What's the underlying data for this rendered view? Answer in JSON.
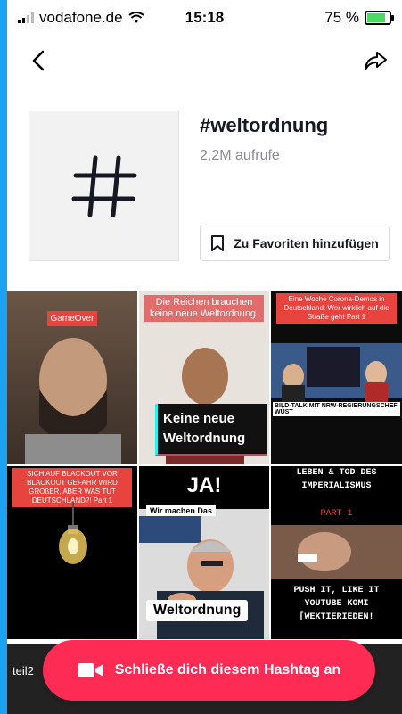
{
  "status_bar": {
    "carrier": "vodafone.de",
    "time": "15:18",
    "battery_percent": "75 %",
    "battery_level": 0.75
  },
  "header": {
    "title": "#weltordnung",
    "views": "2,2M aufrufe",
    "favorite_label": "Zu Favoriten hinzufügen"
  },
  "grid": [
    {
      "caption": "GameOver",
      "bg": "#5a4a3e"
    },
    {
      "caption": "Die Reichen brauchen keine neue Weltordnung.",
      "subcaption": "Keine neue Weltordnung",
      "bg": "#e7e2dc"
    },
    {
      "caption": "Eine Woche Corona-Demos in Deutschland: Wer wirklich auf die Straße geht Part 1",
      "subcaption": "BILD-TALK MIT NRW-REGIERUNGSCHEF WÜST",
      "bg": "#111"
    },
    {
      "caption": "SICH AUF BLACKOUT VOR BLACKOUT GEFAHR WIRD GRÖßER, ABER WAS TUT DEUTSCHLAND?! Part 1",
      "bg": "#000"
    },
    {
      "caption": "JA!",
      "subcaption": "Wir machen Das",
      "label": "Weltordnung",
      "bg": "#1a1a1a"
    },
    {
      "caption": "LEBEN & TOD DES IMPERIALISMUS",
      "part": "PART 1",
      "subcaption": "PUSH IT, LIKE IT YOUTUBE KOMI [WEKTIERIEDEN!",
      "bg": "#000"
    }
  ],
  "partial_row_text": "teil2",
  "cta": {
    "label": "Schließe dich diesem Hashtag an"
  },
  "colors": {
    "accent": "#fe2c55",
    "frame": "#1da1f2"
  },
  "icons": [
    "back-arrow-icon",
    "share-icon",
    "hashtag-icon",
    "bookmark-icon",
    "video-camera-icon"
  ]
}
